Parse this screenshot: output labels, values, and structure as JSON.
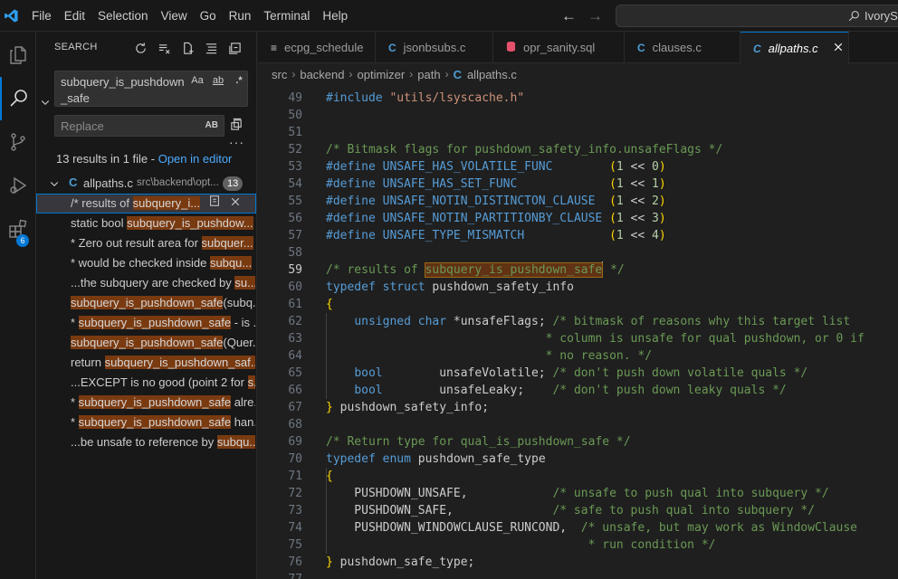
{
  "menu": [
    "File",
    "Edit",
    "Selection",
    "View",
    "Go",
    "Run",
    "Terminal",
    "Help"
  ],
  "command_center": {
    "text": "IvorySQL"
  },
  "activity_bar": {
    "extensions_badge": "6"
  },
  "sidebar": {
    "title": "SEARCH",
    "search_value": "subquery_is_pushdown_safe",
    "option_labels": [
      "Aa",
      "ab",
      ".*"
    ],
    "replace_placeholder": "Replace",
    "replace_toggle": "AB",
    "results_text": "13 results in 1 file - ",
    "open_in_editor": "Open in editor",
    "file": {
      "name": "allpaths.c",
      "path": "src\\backend\\opt...",
      "count": "13",
      "icon": "C"
    },
    "matches": [
      {
        "pre": "/* results of ",
        "hit": "subquery_i...",
        "post": ""
      },
      {
        "pre": "static bool ",
        "hit": "subquery_is_pushdow...",
        "post": ""
      },
      {
        "pre": "* Zero out result area for ",
        "hit": "subquer...",
        "post": ""
      },
      {
        "pre": "* would be checked inside ",
        "hit": "subqu...",
        "post": ""
      },
      {
        "pre": "...the subquery are checked by ",
        "hit": "su...",
        "post": ""
      },
      {
        "pre": "",
        "hit": "subquery_is_pushdown_safe",
        "post": "(subq..."
      },
      {
        "pre": "* ",
        "hit": "subquery_is_pushdown_safe",
        "post": " - is ..."
      },
      {
        "pre": "",
        "hit": "subquery_is_pushdown_safe",
        "post": "(Quer..."
      },
      {
        "pre": "return ",
        "hit": "subquery_is_pushdown_saf...",
        "post": ""
      },
      {
        "pre": "...EXCEPT is no good (point 2 for ",
        "hit": "s...",
        "post": ""
      },
      {
        "pre": "* ",
        "hit": "subquery_is_pushdown_safe",
        "post": " alre..."
      },
      {
        "pre": "* ",
        "hit": "subquery_is_pushdown_safe",
        "post": " han..."
      },
      {
        "pre": "...be unsafe to reference by ",
        "hit": "subqu...",
        "post": ""
      }
    ]
  },
  "tabs": [
    {
      "label": "ecpg_schedule",
      "icon": "≡"
    },
    {
      "label": "jsonbsubs.c",
      "icon": "C"
    },
    {
      "label": "opr_sanity.sql",
      "icon": "db"
    },
    {
      "label": "clauses.c",
      "icon": "C"
    },
    {
      "label": "allpaths.c",
      "icon": "C"
    }
  ],
  "breadcrumb": [
    "src",
    "backend",
    "optimizer",
    "path",
    "allpaths.c"
  ],
  "editor": {
    "lines": [
      {
        "n": "49",
        "segs": [
          [
            "pp",
            "#include "
          ],
          [
            "str",
            "\"utils/lsyscache.h\""
          ]
        ]
      },
      {
        "n": "50",
        "segs": []
      },
      {
        "n": "51",
        "segs": []
      },
      {
        "n": "52",
        "segs": [
          [
            "com",
            "/* Bitmask flags for pushdown_safety_info.unsafeFlags */"
          ]
        ]
      },
      {
        "n": "53",
        "segs": [
          [
            "pp",
            "#define "
          ],
          [
            "mac",
            "UNSAFE_HAS_VOLATILE_FUNC        "
          ],
          [
            "par",
            "("
          ],
          [
            "num",
            "1"
          ],
          [
            "txt",
            " << "
          ],
          [
            "num",
            "0"
          ],
          [
            "par",
            ")"
          ]
        ]
      },
      {
        "n": "54",
        "segs": [
          [
            "pp",
            "#define "
          ],
          [
            "mac",
            "UNSAFE_HAS_SET_FUNC             "
          ],
          [
            "par",
            "("
          ],
          [
            "num",
            "1"
          ],
          [
            "txt",
            " << "
          ],
          [
            "num",
            "1"
          ],
          [
            "par",
            ")"
          ]
        ]
      },
      {
        "n": "55",
        "segs": [
          [
            "pp",
            "#define "
          ],
          [
            "mac",
            "UNSAFE_NOTIN_DISTINCTON_CLAUSE  "
          ],
          [
            "par",
            "("
          ],
          [
            "num",
            "1"
          ],
          [
            "txt",
            " << "
          ],
          [
            "num",
            "2"
          ],
          [
            "par",
            ")"
          ]
        ]
      },
      {
        "n": "56",
        "segs": [
          [
            "pp",
            "#define "
          ],
          [
            "mac",
            "UNSAFE_NOTIN_PARTITIONBY_CLAUSE "
          ],
          [
            "par",
            "("
          ],
          [
            "num",
            "1"
          ],
          [
            "txt",
            " << "
          ],
          [
            "num",
            "3"
          ],
          [
            "par",
            ")"
          ]
        ]
      },
      {
        "n": "57",
        "segs": [
          [
            "pp",
            "#define "
          ],
          [
            "mac",
            "UNSAFE_TYPE_MISMATCH            "
          ],
          [
            "par",
            "("
          ],
          [
            "num",
            "1"
          ],
          [
            "txt",
            " << "
          ],
          [
            "num",
            "4"
          ],
          [
            "par",
            ")"
          ]
        ]
      },
      {
        "n": "58",
        "segs": []
      },
      {
        "n": "59",
        "cur": true,
        "segs": [
          [
            "com",
            "/* results of "
          ],
          [
            "hl",
            "subquery_is_pushdown_safe"
          ],
          [
            "cursor",
            ""
          ],
          [
            "com",
            " */"
          ]
        ]
      },
      {
        "n": "60",
        "segs": [
          [
            "kw",
            "typedef "
          ],
          [
            "kw",
            "struct "
          ],
          [
            "txt",
            "pushdown_safety_info"
          ]
        ]
      },
      {
        "n": "61",
        "segs": [
          [
            "par",
            "{"
          ]
        ]
      },
      {
        "n": "62",
        "segs": [
          [
            "txt",
            "    "
          ],
          [
            "kw",
            "unsigned "
          ],
          [
            "kw",
            "char "
          ],
          [
            "txt",
            "*unsafeFlags; "
          ],
          [
            "com",
            "/* bitmask of reasons why this target list"
          ]
        ]
      },
      {
        "n": "63",
        "segs": [
          [
            "txt",
            "                              "
          ],
          [
            "com",
            " * column is unsafe for qual pushdown, or 0 if"
          ]
        ]
      },
      {
        "n": "64",
        "segs": [
          [
            "txt",
            "                              "
          ],
          [
            "com",
            " * no reason. */"
          ]
        ]
      },
      {
        "n": "65",
        "segs": [
          [
            "txt",
            "    "
          ],
          [
            "kw",
            "bool        "
          ],
          [
            "txt",
            "unsafeVolatile; "
          ],
          [
            "com",
            "/* don't push down volatile quals */"
          ]
        ]
      },
      {
        "n": "66",
        "segs": [
          [
            "txt",
            "    "
          ],
          [
            "kw",
            "bool        "
          ],
          [
            "txt",
            "unsafeLeaky;    "
          ],
          [
            "com",
            "/* don't push down leaky quals */"
          ]
        ]
      },
      {
        "n": "67",
        "segs": [
          [
            "par",
            "}"
          ],
          [
            "txt",
            " pushdown_safety_info;"
          ]
        ]
      },
      {
        "n": "68",
        "segs": []
      },
      {
        "n": "69",
        "segs": [
          [
            "com",
            "/* Return type for qual_is_pushdown_safe */"
          ]
        ]
      },
      {
        "n": "70",
        "segs": [
          [
            "kw",
            "typedef "
          ],
          [
            "kw",
            "enum "
          ],
          [
            "txt",
            "pushdown_safe_type"
          ]
        ]
      },
      {
        "n": "71",
        "segs": [
          [
            "par",
            "{"
          ]
        ]
      },
      {
        "n": "72",
        "segs": [
          [
            "txt",
            "    PUSHDOWN_UNSAFE,            "
          ],
          [
            "com",
            "/* unsafe to push qual into subquery */"
          ]
        ]
      },
      {
        "n": "73",
        "segs": [
          [
            "txt",
            "    PUSHDOWN_SAFE,              "
          ],
          [
            "com",
            "/* safe to push qual into subquery */"
          ]
        ]
      },
      {
        "n": "74",
        "segs": [
          [
            "txt",
            "    PUSHDOWN_WINDOWCLAUSE_RUNCOND,  "
          ],
          [
            "com",
            "/* unsafe, but may work as WindowClause"
          ]
        ]
      },
      {
        "n": "75",
        "segs": [
          [
            "txt",
            "                                    "
          ],
          [
            "com",
            " * run condition */"
          ]
        ]
      },
      {
        "n": "76",
        "segs": [
          [
            "par",
            "}"
          ],
          [
            "txt",
            " pushdown_safe_type;"
          ]
        ]
      },
      {
        "n": "77",
        "segs": []
      }
    ]
  },
  "colors": {
    "accent": "#0078d4",
    "match_highlight": "#7a3a10"
  }
}
